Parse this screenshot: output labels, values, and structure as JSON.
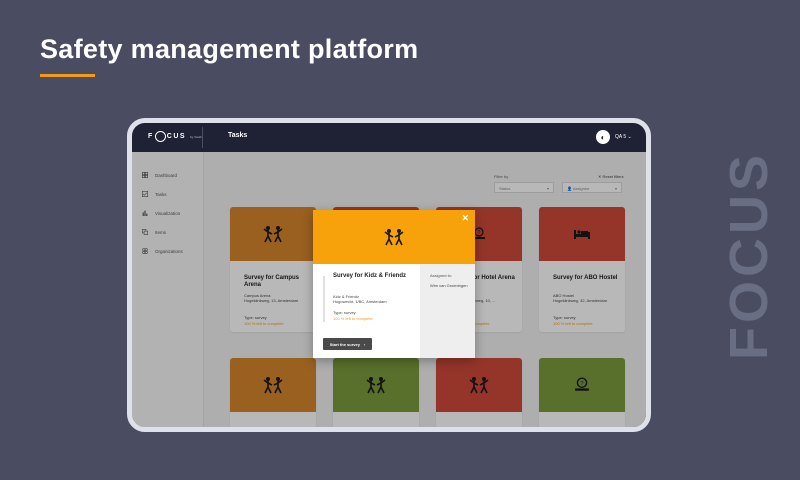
{
  "hero": {
    "title": "Safety management platform",
    "brand_vertical": "FOCUS"
  },
  "app": {
    "logo_text": "F CUS",
    "logo_sub": "by Vouth",
    "page_title": "Tasks",
    "user": {
      "avatar_glyph": "◐",
      "name": "QA 5 ⌄"
    }
  },
  "sidebar": {
    "items": [
      {
        "label": "Dashboard",
        "icon": "grid-icon"
      },
      {
        "label": "Tasks",
        "icon": "checkbox-icon"
      },
      {
        "label": "Visualization",
        "icon": "bar-chart-icon"
      },
      {
        "label": "Items",
        "icon": "copy-icon"
      },
      {
        "label": "Organizations",
        "icon": "org-icon"
      }
    ]
  },
  "filters": {
    "label": "Filter by",
    "reset": "✕ Reset filters",
    "status_placeholder": "Status",
    "assignee_placeholder": "Assignee"
  },
  "cards": [
    {
      "color": "#d4862b",
      "icon": "people-icon",
      "title": "Survey for Campus Arena",
      "address": "Campus Arena\nHogeklinkweg, 13, Amsterdam",
      "type": "Type: survey",
      "progress": "100 % left to complete"
    },
    {
      "color": "#cf4a3a",
      "icon": "people-icon",
      "title": "Survey for Hotel Arena",
      "address": "Hotel Arena\n's-Gravesandeweg, 10, ...",
      "type": "Type: survey",
      "progress": "100 % left to complete"
    },
    {
      "color": "#cf4a3a",
      "icon": "bed-icon",
      "title": "Survey for ABO Hostel",
      "address": "ABO Hostel\nHogeklinkweg, 32, Amsterdam",
      "type": "Type: survey",
      "progress": "100 % left to complete"
    },
    {
      "color": "#d4862b",
      "icon": "people-icon"
    },
    {
      "color": "#7c9a3e",
      "icon": "people-icon"
    },
    {
      "color": "#cf4a3a",
      "icon": "people-icon"
    },
    {
      "color": "#7c9a3e",
      "icon": "bed-icon"
    }
  ],
  "modal": {
    "title": "Survey for Kidz & Friendz",
    "address": "Kidz & Friendz\nHugowecht, 1/BC, Amsterdam",
    "type": "Type: survey",
    "progress": "100 % left to complete",
    "assigned_label": "Assigned to:",
    "assigned_name": "Wim van Groeningen",
    "start_button": "Start the survey",
    "start_arrow": "›",
    "close_glyph": "✕",
    "header_color": "#f7a20a"
  }
}
